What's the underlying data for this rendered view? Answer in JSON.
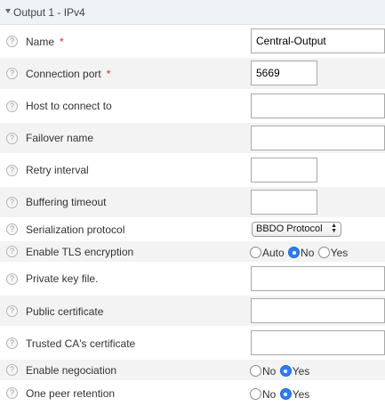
{
  "section": {
    "title": "Output 1 - IPv4"
  },
  "help_glyph": "?",
  "fields": {
    "name": {
      "label": "Name",
      "required": "*",
      "value": "Central-Output"
    },
    "connection_port": {
      "label": "Connection port",
      "required": "*",
      "value": "5669"
    },
    "host": {
      "label": "Host to connect to",
      "value": ""
    },
    "failover": {
      "label": "Failover name",
      "value": ""
    },
    "retry": {
      "label": "Retry interval",
      "value": ""
    },
    "buffering": {
      "label": "Buffering timeout",
      "value": ""
    },
    "serialization": {
      "label": "Serialization protocol",
      "selected": "BBDO Protocol"
    },
    "tls": {
      "label": "Enable TLS encryption",
      "options": [
        "Auto",
        "No",
        "Yes"
      ],
      "selected": "No"
    },
    "private_key": {
      "label": "Private key file.",
      "value": ""
    },
    "public_cert": {
      "label": "Public certificate",
      "value": ""
    },
    "trusted_ca": {
      "label": "Trusted CA's certificate",
      "value": ""
    },
    "negociation": {
      "label": "Enable negociation",
      "options": [
        "No",
        "Yes"
      ],
      "selected": "Yes"
    },
    "peer_retention": {
      "label": "One peer retention",
      "options": [
        "No",
        "Yes"
      ],
      "selected": "Yes"
    }
  }
}
